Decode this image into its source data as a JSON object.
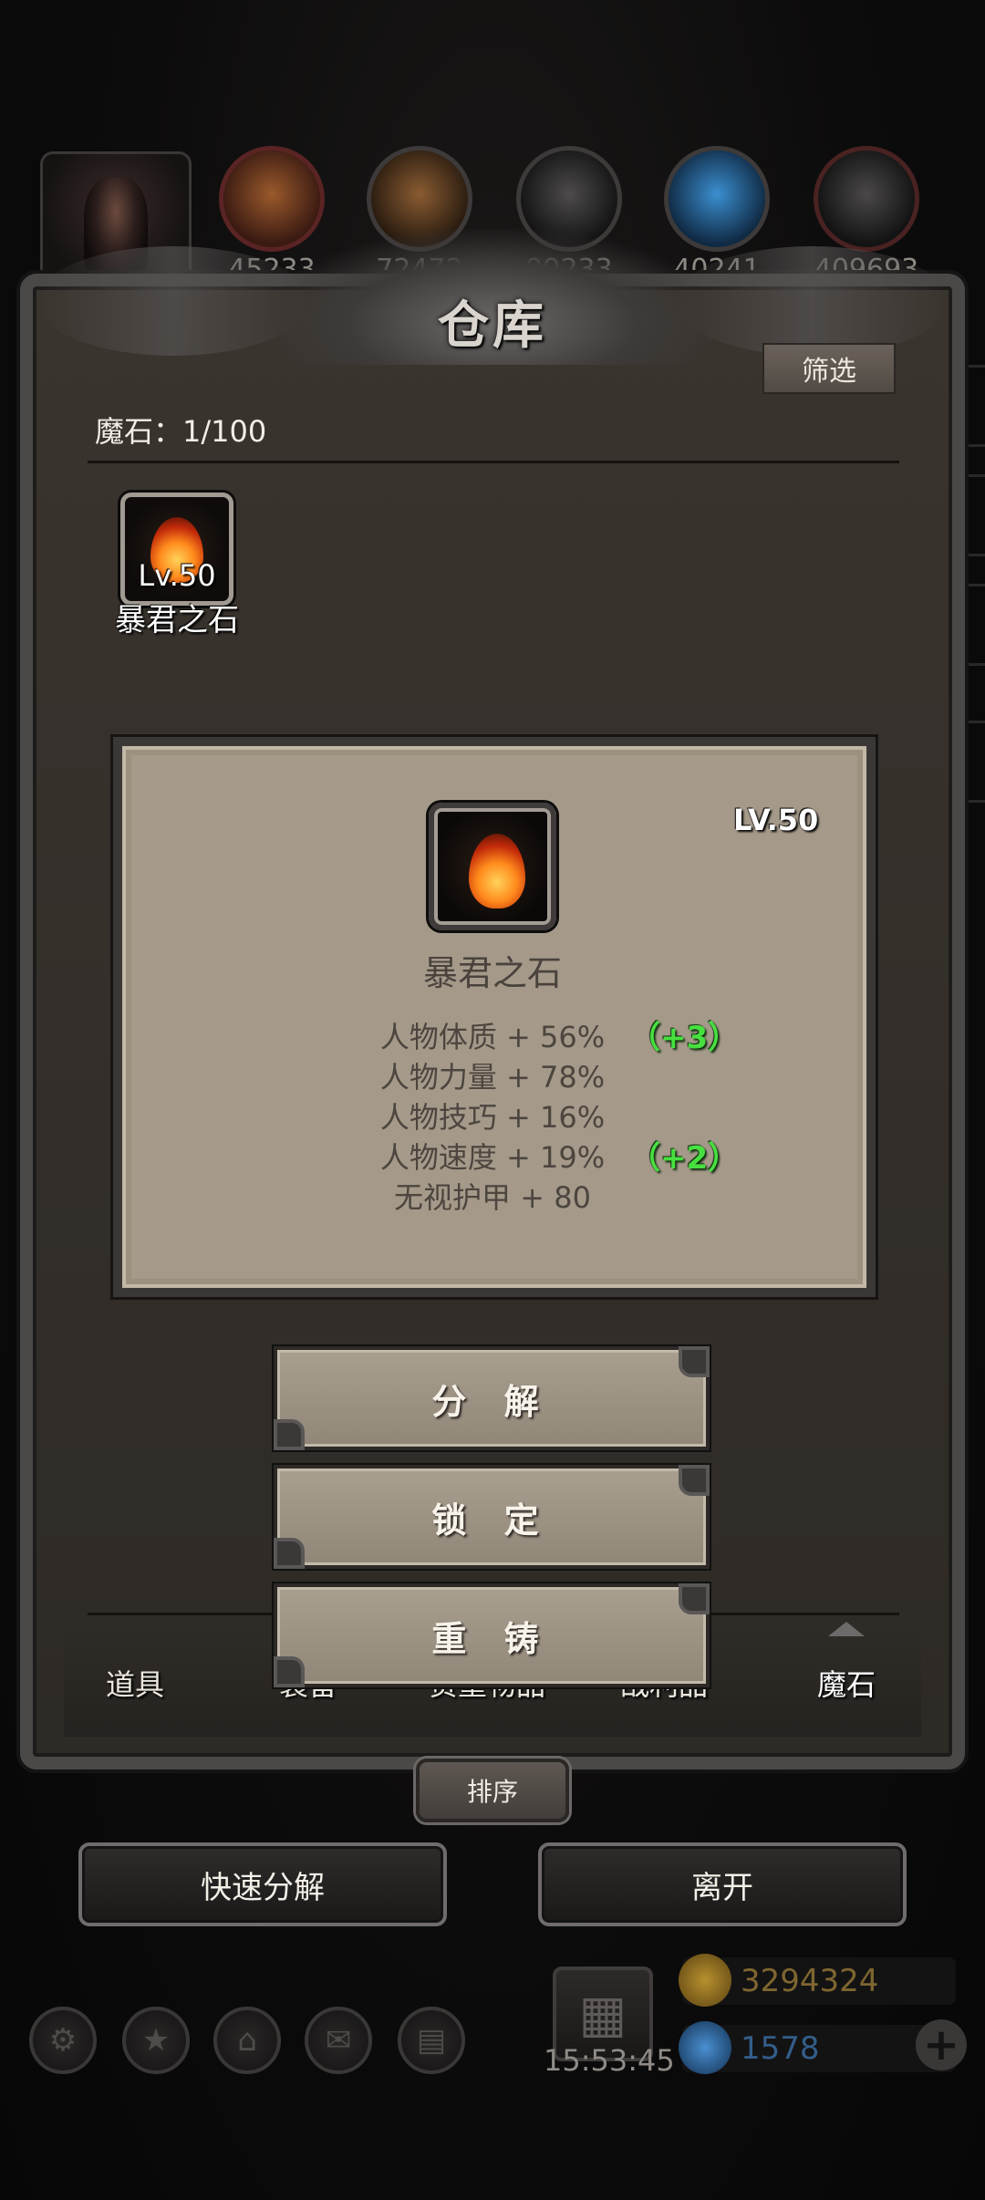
{
  "top_bar": {
    "resources": [
      {
        "name": "copper-ore-icon",
        "count": "45233"
      },
      {
        "name": "wood-plank-icon",
        "count": "72472"
      },
      {
        "name": "iron-ingot-icon",
        "count": "99233"
      },
      {
        "name": "blue-crystal-icon",
        "count": "40241"
      },
      {
        "name": "dark-stone-icon",
        "count": "409693"
      }
    ]
  },
  "panel": {
    "title": "仓库",
    "filter_label": "筛选",
    "capacity": "魔石：1/100"
  },
  "inventory": [
    {
      "level": "Lv.50",
      "name": "暴君之石",
      "icon": "flame-stone-icon"
    }
  ],
  "detail": {
    "level": "LV.50",
    "name": "暴君之石",
    "stats": [
      {
        "text": "人物体质 + 56%",
        "bonus": "（+3）"
      },
      {
        "text": "人物力量 + 78%",
        "bonus": ""
      },
      {
        "text": "人物技巧 + 16%",
        "bonus": ""
      },
      {
        "text": "人物速度 + 19%",
        "bonus": "（+2）"
      },
      {
        "text": "无视护甲 + 80",
        "bonus": ""
      }
    ]
  },
  "actions": {
    "decompose": "分 解",
    "lock": "锁 定",
    "recast": "重 铸"
  },
  "tabs": [
    {
      "label": "道具",
      "active": false
    },
    {
      "label": "装备",
      "active": false
    },
    {
      "label": "贵重物品",
      "active": false
    },
    {
      "label": "战利品",
      "active": false
    },
    {
      "label": "魔石",
      "active": true
    }
  ],
  "sort_label": "排序",
  "footer": {
    "quick_decompose": "快速分解",
    "leave": "离开"
  },
  "hud": {
    "timer": "15:53:45",
    "gold": "3294324",
    "gems": "1578",
    "gold_color": "#a07a2c",
    "gem_color": "#2f6fa8"
  }
}
